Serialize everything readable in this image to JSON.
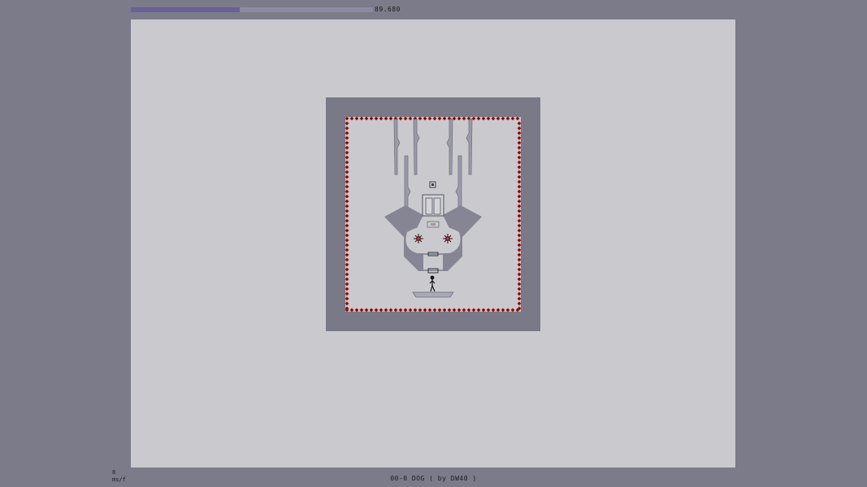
{
  "hud": {
    "time_value": "89.680",
    "time_fraction": 0.45,
    "time_color": "#6b5f98",
    "fps_value": "8",
    "fps_unit": "ms/f"
  },
  "level": {
    "title": "00-0 DOG ( by DW40 )",
    "frame_color": "#797988",
    "floor_color": "#cacace",
    "hazard_color": "#b01818"
  },
  "icons": {
    "player": "ninja-stickfigure",
    "exit_door": "exit-door-icon",
    "switch": "exit-switch-icon",
    "mines": "mine-icon",
    "launch_pads": "launch-pad-icon"
  }
}
